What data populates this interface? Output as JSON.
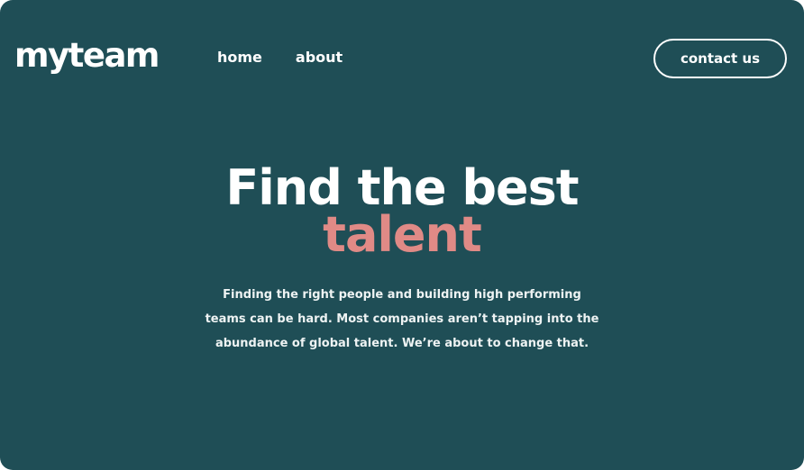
{
  "header": {
    "logo": "myteam",
    "nav": [
      {
        "label": "home"
      },
      {
        "label": "about"
      }
    ],
    "contact_label": "contact us"
  },
  "hero": {
    "title": "Find the best",
    "accent": "talent",
    "description": "Finding the right people and building high performing teams can be hard. Most companies aren’t tapping into the abundance of global talent. We’re about to change that."
  },
  "colors": {
    "background": "#1f4e56",
    "accent": "#e08a86",
    "text": "#ffffff"
  }
}
